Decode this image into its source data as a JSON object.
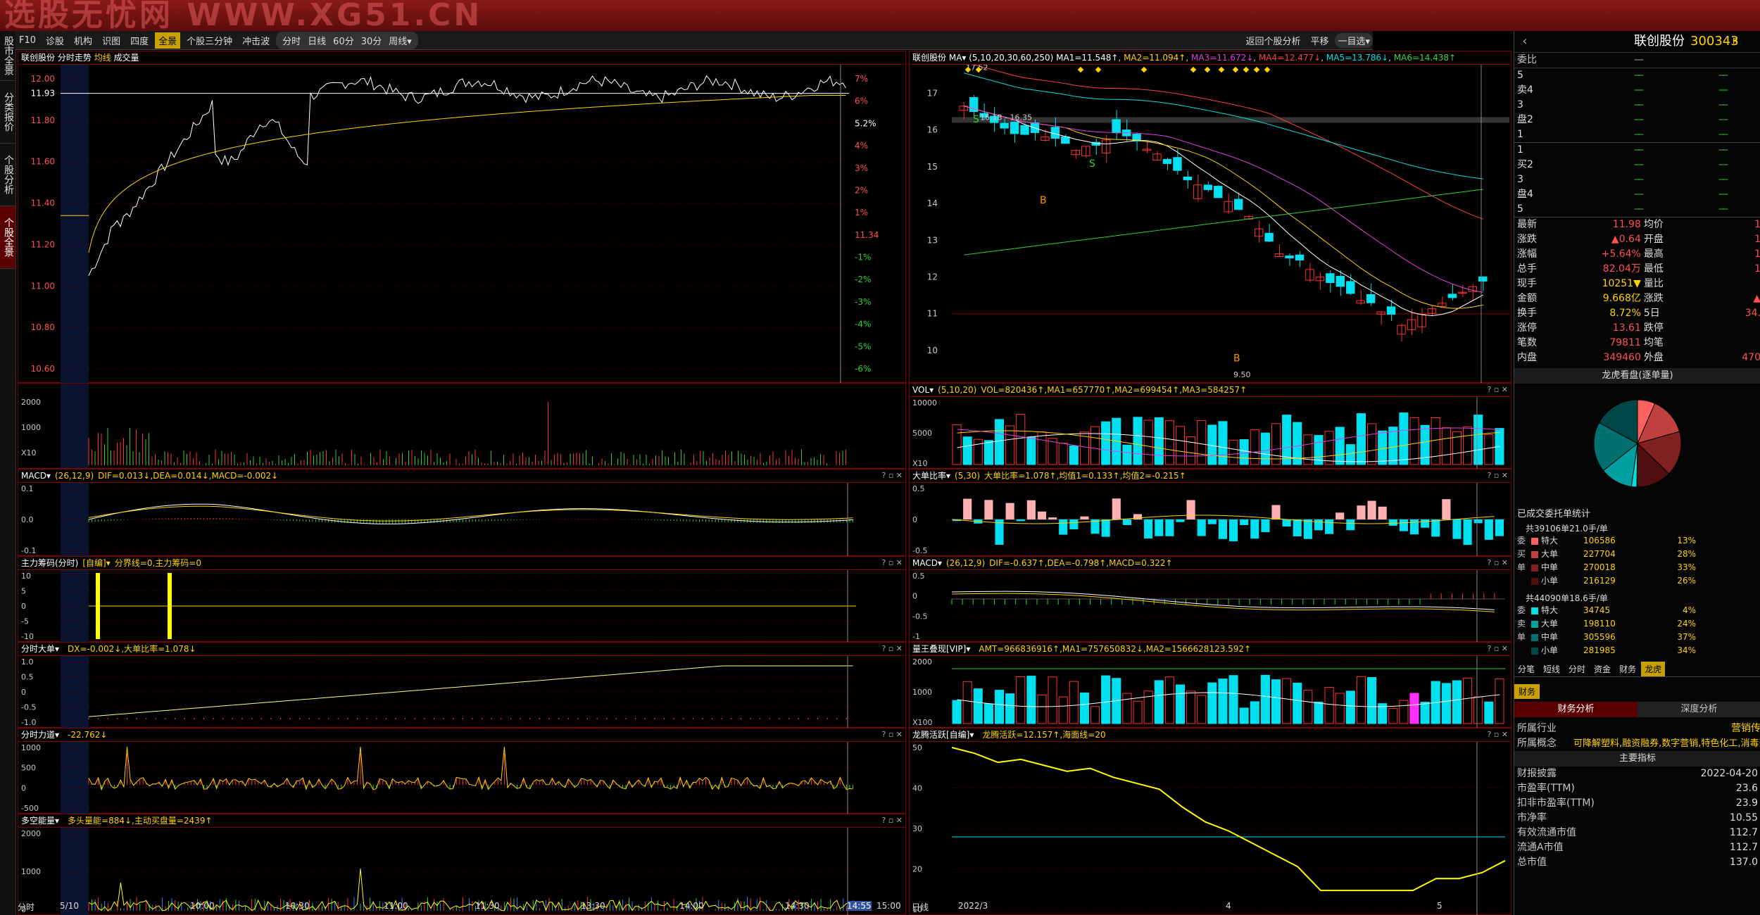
{
  "watermark": "选股无忧网 WWW.XG51.CN",
  "left_tabs": [
    "股市全景",
    "分类报价",
    "个股分析",
    "个股全景"
  ],
  "toolbar": {
    "items": [
      "F10",
      "诊股",
      "机构",
      "识图",
      "四度",
      "全景",
      "个股三分钟",
      "冲击波"
    ],
    "periods": [
      "分时",
      "日线",
      "60分",
      "30分",
      "周线▾"
    ],
    "right": [
      "返回个股分析",
      "平移",
      "一目选▾"
    ]
  },
  "intraday": {
    "title": "联创股份",
    "tab1": "分时走势",
    "tab2": "均线",
    "tab3": "成交量",
    "price_ticks": [
      "12.00",
      "11.93",
      "11.80",
      "11.60",
      "11.40",
      "11.20",
      "11.00",
      "10.80",
      "10.60"
    ],
    "pct_ticks": [
      "7%",
      "6%",
      "5.2%",
      "4%",
      "3%",
      "2%",
      "1%",
      "11.34",
      "-1%",
      "-2%",
      "-3%",
      "-4%",
      "-5%",
      "-6%"
    ],
    "vol_ticks": [
      "2000",
      "1000",
      "X10"
    ],
    "time_ticks": [
      "分时",
      "5/10",
      "10:00",
      "10:30",
      "11:00",
      "11:30",
      "13:30",
      "14:00",
      "14:30",
      "14:55",
      "15:00"
    ]
  },
  "ind_left": [
    {
      "name": "MACD▾",
      "params": "(26,12,9)",
      "vals": "DIF=0.013↓,DEA=0.014↓,MACD=-0.002↓",
      "ticks": [
        "0.1",
        "0.0",
        "-0.1"
      ]
    },
    {
      "name": "主力筹码(分时)",
      "params": "[自编]▾",
      "vals": "分界线=0,主力筹码=0",
      "ticks": [
        "10",
        "5",
        "0",
        "-5",
        "-10"
      ]
    },
    {
      "name": "分时大单▾",
      "params": "",
      "vals": "DX=-0.002↓,大单比率=1.078↓",
      "ticks": [
        "1.0",
        "0.5",
        "0",
        "-0.5",
        "-1.0"
      ]
    },
    {
      "name": "分时力道▾",
      "params": "",
      "vals": "-22.762↓",
      "ticks": [
        "1000",
        "500",
        "0",
        "-500"
      ]
    },
    {
      "name": "多空能量▾",
      "params": "",
      "vals": "多头量能=884↓,主动买盘量=2439↑",
      "ticks": [
        "2000",
        "1000",
        "0"
      ]
    }
  ],
  "kline": {
    "title": "联创股份",
    "ma": "MA▾ (5,10,20,30,60,250)",
    "ma_vals": [
      "MA1=11.548↑",
      "MA2=11.094↑",
      "MA3=11.672↓",
      "MA4=12.477↓",
      "MA5=13.786↓",
      "MA6=14.438↑"
    ],
    "price_ticks": [
      "17",
      "16",
      "15",
      "14",
      "13",
      "12",
      "11",
      "10"
    ],
    "labels": [
      "17.52",
      "16.18 - 16.35",
      "9.50",
      "S",
      "S",
      "B",
      "B"
    ],
    "date_ticks": [
      "日线",
      "2022/3",
      "4",
      "5"
    ]
  },
  "ind_right": [
    {
      "name": "VOL▾",
      "params": "(5,10,20)",
      "vals": "VOL=820436↑,MA1=657770↑,MA2=699454↑,MA3=584257↑",
      "ticks": [
        "10000",
        "5000",
        "X10"
      ]
    },
    {
      "name": "大单比率▾",
      "params": "(5,30)",
      "vals": "大单比率=1.078↑,均值1=0.133↑,均值2=-0.215↑",
      "ticks": [
        "0.5",
        "0",
        "-0.5"
      ]
    },
    {
      "name": "MACD▾",
      "params": "(26,12,9)",
      "vals": "DIF=-0.637↑,DEA=-0.798↑,MACD=0.322↑",
      "ticks": [
        "0.5",
        "0",
        "-0.5",
        "-1"
      ]
    },
    {
      "name": "量王叠现[VIP]▾",
      "params": "",
      "vals": "AMT=966836916↑,MA1=757650832↓,MA2=1566628123.592↑",
      "ticks": [
        "2000",
        "1000",
        "X100"
      ]
    },
    {
      "name": "龙腾活跃[自编]▾",
      "params": "",
      "vals": "龙腾活跃=12.157↑,海面线=20",
      "ticks": [
        "50",
        "40",
        "30",
        "20",
        "10"
      ]
    }
  ],
  "right": {
    "name": "联创股份",
    "code": "300343",
    "flag": "R",
    "weibi_label": "委比",
    "weibi_val": "—",
    "sell": [
      [
        "5",
        "—",
        "—"
      ],
      [
        "卖4",
        "—",
        "—"
      ],
      [
        "3",
        "—",
        "—"
      ],
      [
        "盘2",
        "—",
        "—"
      ],
      [
        "1",
        "—",
        "—"
      ]
    ],
    "buy": [
      [
        "1",
        "—",
        "—"
      ],
      [
        "买2",
        "—",
        "—"
      ],
      [
        "3",
        "—",
        "—"
      ],
      [
        "盘4",
        "—",
        "—"
      ],
      [
        "5",
        "—",
        "—"
      ]
    ],
    "quote": [
      [
        "最新",
        "11.98",
        "均价",
        "1"
      ],
      [
        "涨跌",
        "▲0.64",
        "开盘",
        "1"
      ],
      [
        "涨幅",
        "+5.64%",
        "最高",
        "1"
      ],
      [
        "总手",
        "82.04万",
        "最低",
        "1"
      ],
      [
        "现手",
        "10251▼",
        "量比",
        ""
      ],
      [
        "金额",
        "9.668亿",
        "涨跌",
        "▲"
      ],
      [
        "换手",
        "8.72%",
        "5日",
        "34."
      ],
      [
        "涨停",
        "13.61",
        "跌停",
        ""
      ],
      [
        "笔数",
        "79811",
        "均笔",
        ""
      ],
      [
        "内盘",
        "349460",
        "外盘",
        "470"
      ]
    ],
    "lhb_title": "龙虎看盘(逐单量)",
    "pie": [
      {
        "v": 13,
        "c": "#ff6060"
      },
      {
        "v": 28,
        "c": "#c04040"
      },
      {
        "v": 33,
        "c": "#802020"
      },
      {
        "v": 26,
        "c": "#501010"
      },
      {
        "v": 4,
        "c": "#00e0e0"
      },
      {
        "v": 24,
        "c": "#00a0a0"
      },
      {
        "v": 37,
        "c": "#007070"
      },
      {
        "v": 34,
        "c": "#004848"
      }
    ],
    "stat_title": "已成交委托单统计",
    "buy_total": "共39106单21.0手/单",
    "buy_rows": [
      [
        "委",
        "特大",
        "106586",
        "13%",
        "#ff6060"
      ],
      [
        "买",
        "大单",
        "227704",
        "28%",
        "#c04040"
      ],
      [
        "单",
        "中单",
        "270018",
        "33%",
        "#802020"
      ],
      [
        "",
        "小单",
        "216129",
        "26%",
        "#501010"
      ]
    ],
    "sell_total": "共44090单18.6手/单",
    "sell_rows": [
      [
        "委",
        "特大",
        "34745",
        "4%",
        "#00e0e0"
      ],
      [
        "卖",
        "大单",
        "198110",
        "24%",
        "#00a0a0"
      ],
      [
        "单",
        "中单",
        "305596",
        "37%",
        "#007070"
      ],
      [
        "",
        "小单",
        "281985",
        "34%",
        "#004848"
      ]
    ],
    "tabs": [
      "分笔",
      "短线",
      "分时",
      "资金",
      "财务",
      "龙虎"
    ],
    "fin_tab": "财务",
    "fin_sub1": "财务分析",
    "fin_sub2": "深度分析",
    "industry_label": "所属行业",
    "industry": "营销传",
    "concept_label": "所属概念",
    "concept": "可降解塑料,融资融券,数字营销,特色化工,消毒剂",
    "main_idx": "主要指标",
    "fin": [
      [
        "财报披露",
        "2022-04-20"
      ],
      [
        "市盈率(TTM)",
        "23.6"
      ],
      [
        "扣非市盈率(TTM)",
        "23.9"
      ],
      [
        "市净率",
        "10.55"
      ],
      [
        "有效流通市值",
        "112.7"
      ],
      [
        "流通A市值",
        "112.7"
      ],
      [
        "总市值",
        "137.0"
      ]
    ]
  }
}
